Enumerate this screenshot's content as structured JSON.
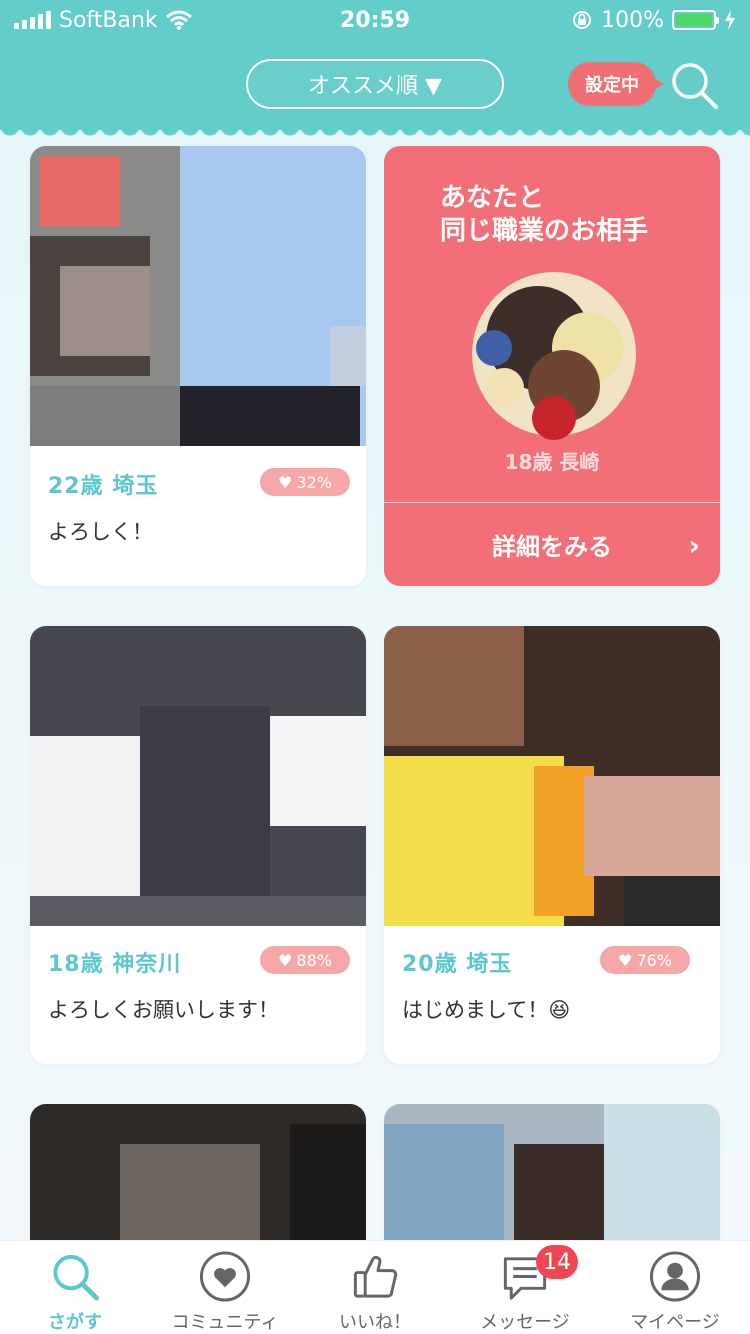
{
  "status_bar": {
    "carrier": "SoftBank",
    "time": "20:59",
    "battery": "100%"
  },
  "header": {
    "sort_label": "オススメ順 ▼",
    "filter_badge": "設定中",
    "search_icon": "search-icon"
  },
  "cards": [
    {
      "age_loc": "22歳  埼玉",
      "likes": "32%",
      "message": "よろしく！"
    },
    {
      "age_loc": "18歳  神奈川",
      "likes": "88%",
      "message": "よろしくお願いします！"
    },
    {
      "age_loc": "20歳  埼玉",
      "likes": "76%",
      "message": "はじめまして！😆"
    }
  ],
  "feature": {
    "title_line1": "あなたと",
    "title_line2": "同じ職業のお相手",
    "profile": "18歳 長崎",
    "detail_label": "詳細をみる",
    "chevron": "›"
  },
  "tabs": [
    {
      "label": "さがす",
      "icon": "search-icon",
      "active": true
    },
    {
      "label": "コミュニティ",
      "icon": "heart-icon"
    },
    {
      "label": "いいね！",
      "icon": "thumbs-up-icon"
    },
    {
      "label": "メッセージ",
      "icon": "message-icon",
      "badge": "14"
    },
    {
      "label": "マイページ",
      "icon": "user-icon"
    }
  ],
  "colors": {
    "accent": "#63cdc9",
    "pink": "#f26f77",
    "badge": "#ef4752",
    "like_pill": "#f6a7a8"
  }
}
